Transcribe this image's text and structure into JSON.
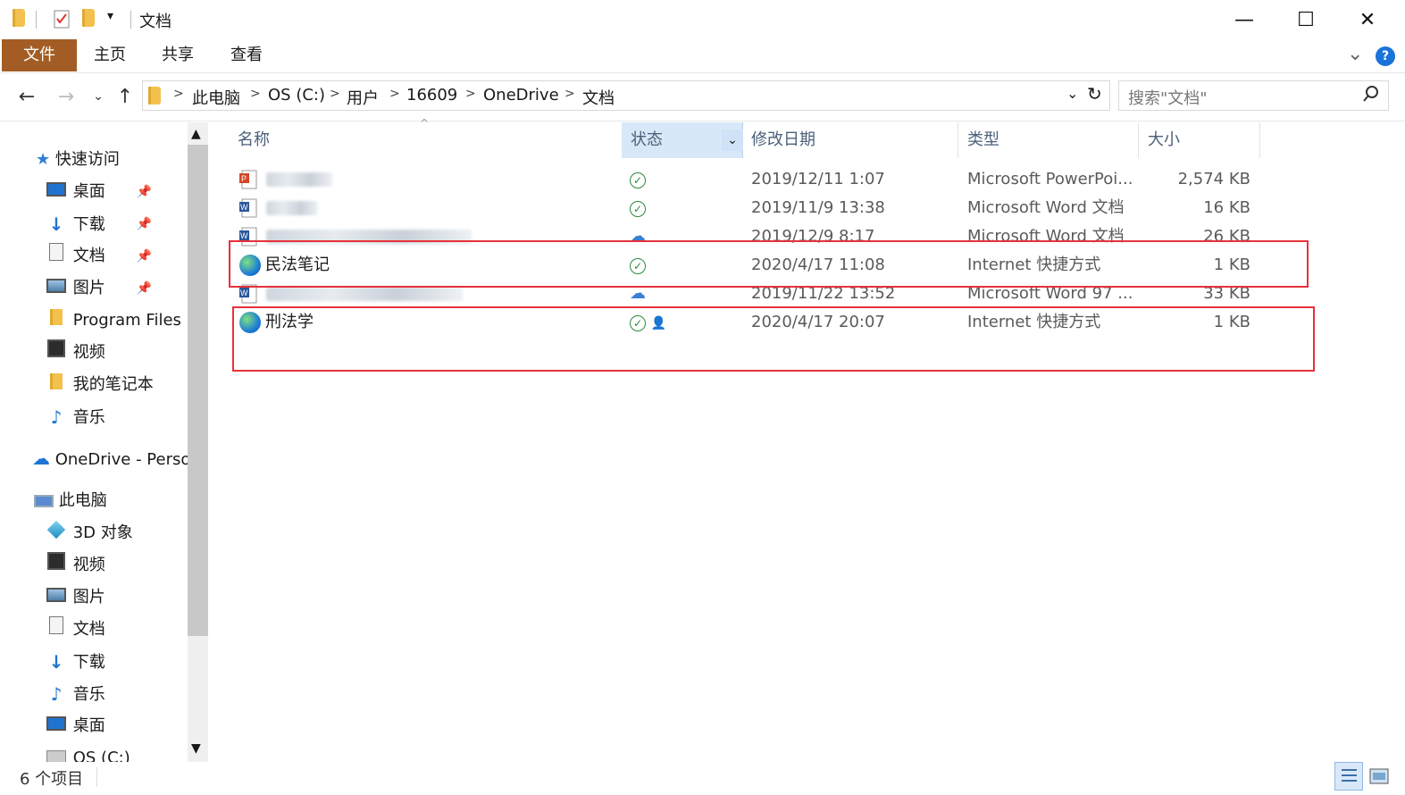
{
  "window": {
    "title": "文档",
    "quick_access_menu": "▾",
    "controls": {
      "minimize": "—",
      "maximize": "☐",
      "close": "✕"
    }
  },
  "ribbon": {
    "tabs": [
      "文件",
      "主页",
      "共享",
      "查看"
    ],
    "collapse_chevron": "⌄",
    "help": "?"
  },
  "address": {
    "breadcrumbs": [
      "此电脑",
      "OS (C:)",
      "用户",
      "16609",
      "OneDrive",
      "文档"
    ],
    "search_placeholder": "搜索\"文档\""
  },
  "sidebar": {
    "quick_access": {
      "label": "快速访问",
      "icon": "star-icon"
    },
    "quick_items": [
      {
        "label": "桌面",
        "icon": "desktop-icon",
        "pinned": true
      },
      {
        "label": "下载",
        "icon": "download-icon",
        "pinned": true
      },
      {
        "label": "文档",
        "icon": "documents-icon",
        "pinned": true
      },
      {
        "label": "图片",
        "icon": "pictures-icon",
        "pinned": true
      },
      {
        "label": "Program Files (",
        "icon": "folder-icon",
        "pinned": false
      },
      {
        "label": "视频",
        "icon": "videos-icon",
        "pinned": false
      },
      {
        "label": "我的笔记本",
        "icon": "folder-icon",
        "pinned": false
      },
      {
        "label": "音乐",
        "icon": "music-icon",
        "pinned": false
      }
    ],
    "onedrive": {
      "label": "OneDrive - Perso",
      "icon": "onedrive-icon"
    },
    "this_pc": {
      "label": "此电脑",
      "icon": "computer-icon"
    },
    "pc_items": [
      {
        "label": "3D 对象",
        "icon": "3d-objects-icon"
      },
      {
        "label": "视频",
        "icon": "videos-icon"
      },
      {
        "label": "图片",
        "icon": "pictures-icon"
      },
      {
        "label": "文档",
        "icon": "documents-icon"
      },
      {
        "label": "下载",
        "icon": "download-icon"
      },
      {
        "label": "音乐",
        "icon": "music-icon"
      },
      {
        "label": "桌面",
        "icon": "desktop-icon"
      },
      {
        "label": "OS (C:)",
        "icon": "drive-icon"
      }
    ]
  },
  "columns": [
    "名称",
    "状态",
    "修改日期",
    "类型",
    "大小"
  ],
  "files": [
    {
      "name": "",
      "icon": "powerpoint-file-icon",
      "status": "synced",
      "date": "2019/12/11 1:07",
      "type": "Microsoft PowerPoi...",
      "size": "2,574 KB",
      "blurred": true
    },
    {
      "name": "",
      "icon": "word-file-icon",
      "status": "synced",
      "date": "2019/11/9 13:38",
      "type": "Microsoft Word 文档",
      "size": "16 KB",
      "blurred": true
    },
    {
      "name": "",
      "icon": "word-file-icon",
      "status": "cloud",
      "date": "2019/12/9 8:17",
      "type": "Microsoft Word 文档",
      "size": "26 KB",
      "blurred": true
    },
    {
      "name": "民法笔记",
      "icon": "internet-shortcut-icon",
      "status": "synced",
      "date": "2020/4/17 11:08",
      "type": "Internet 快捷方式",
      "size": "1 KB",
      "blurred": false
    },
    {
      "name": "",
      "icon": "word-file-icon",
      "status": "cloud",
      "date": "2019/11/22 13:52",
      "type": "Microsoft Word 97 ...",
      "size": "33 KB",
      "blurred": true
    },
    {
      "name": "刑法学",
      "icon": "internet-shortcut-icon",
      "status": "synced-shared",
      "date": "2020/4/17 20:07",
      "type": "Internet 快捷方式",
      "size": "1 KB",
      "blurred": false
    }
  ],
  "status_bar": {
    "item_count": "6 个项目"
  },
  "colors": {
    "file_tab": "#a35d24",
    "highlight": "#e6313a",
    "header_text": "#4c607a",
    "sync_ok": "#2b8a3e"
  }
}
